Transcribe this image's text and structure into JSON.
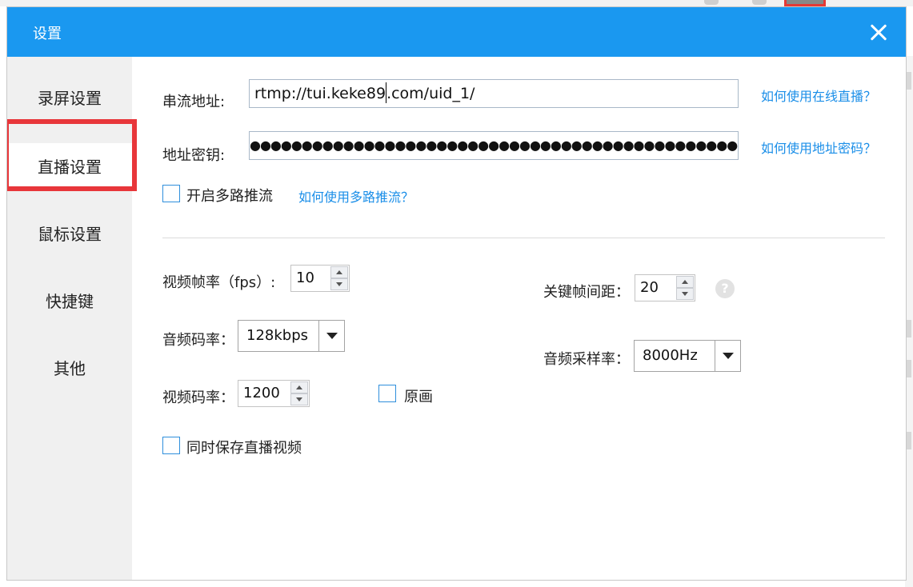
{
  "dialog": {
    "title": "设置",
    "accent_color": "#1a98f0",
    "highlight_color": "#e8363a"
  },
  "sidebar": {
    "items": [
      {
        "label": "录屏设置",
        "active": false
      },
      {
        "label": "直播设置",
        "active": true
      },
      {
        "label": "鼠标设置",
        "active": false
      },
      {
        "label": "快捷键",
        "active": false
      },
      {
        "label": "其他",
        "active": false
      }
    ]
  },
  "stream": {
    "url_label": "串流地址:",
    "url_before_cursor": "rtmp://tui.keke89",
    "url_after_cursor": ".com/uid_1/",
    "url_help": "如何使用在线直播？",
    "key_label": "地址密钥:",
    "key_masked": "●●●●●●●●●●●●●●●●●●●●●●●●●●●●●●●●●●●●●●●●●●●●●●●●●●●●●",
    "key_help": "如何使用地址密码？",
    "multi_label": "开启多路推流",
    "multi_help": "如何使用多路推流？"
  },
  "video": {
    "fps_label": "视频帧率（fps）:",
    "fps_value": "10",
    "keyframe_label": "关键帧间距：",
    "keyframe_value": "20",
    "help_glyph": "?",
    "audio_bitrate_label": "音频码率：",
    "audio_bitrate_value": "128kbps",
    "sample_rate_label": "音频采样率：",
    "sample_rate_value": "8000Hz",
    "video_bitrate_label": "视频码率：",
    "video_bitrate_value": "1200",
    "original_label": "原画",
    "save_label": "同时保存直播视频"
  }
}
